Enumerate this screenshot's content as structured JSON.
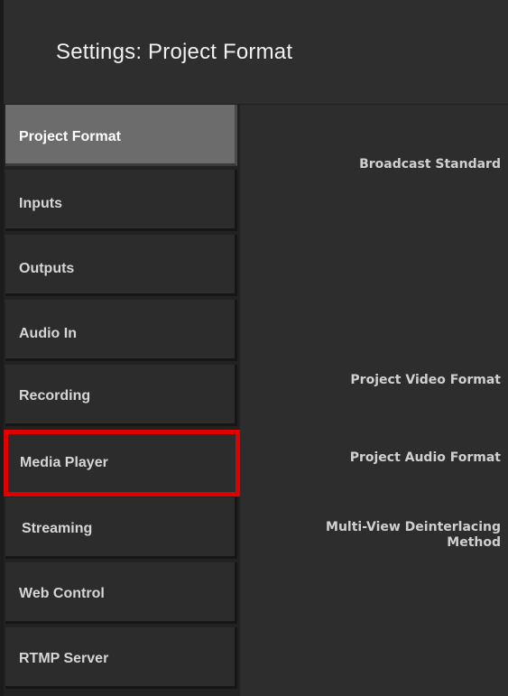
{
  "window": {
    "title": "Settings: Project Format"
  },
  "sidebar": {
    "items": [
      {
        "label": "Project Format"
      },
      {
        "label": "Inputs"
      },
      {
        "label": "Outputs"
      },
      {
        "label": "Audio In"
      },
      {
        "label": "Recording"
      },
      {
        "label": "Media Player"
      },
      {
        "label": "Streaming"
      },
      {
        "label": "Web Control"
      },
      {
        "label": "RTMP Server"
      }
    ],
    "active_item": "Project Format",
    "highlighted_item": "Media Player"
  },
  "content": {
    "fields": [
      {
        "label": "Broadcast Standard"
      },
      {
        "label": "Project Video Format"
      },
      {
        "label": "Project Audio Format"
      },
      {
        "label": "Multi-View Deinterlacing\nMethod"
      }
    ]
  },
  "colors": {
    "highlight": "#e00000",
    "active_item_bg": "#6c6c6c",
    "item_bg": "#2c2c2c"
  }
}
